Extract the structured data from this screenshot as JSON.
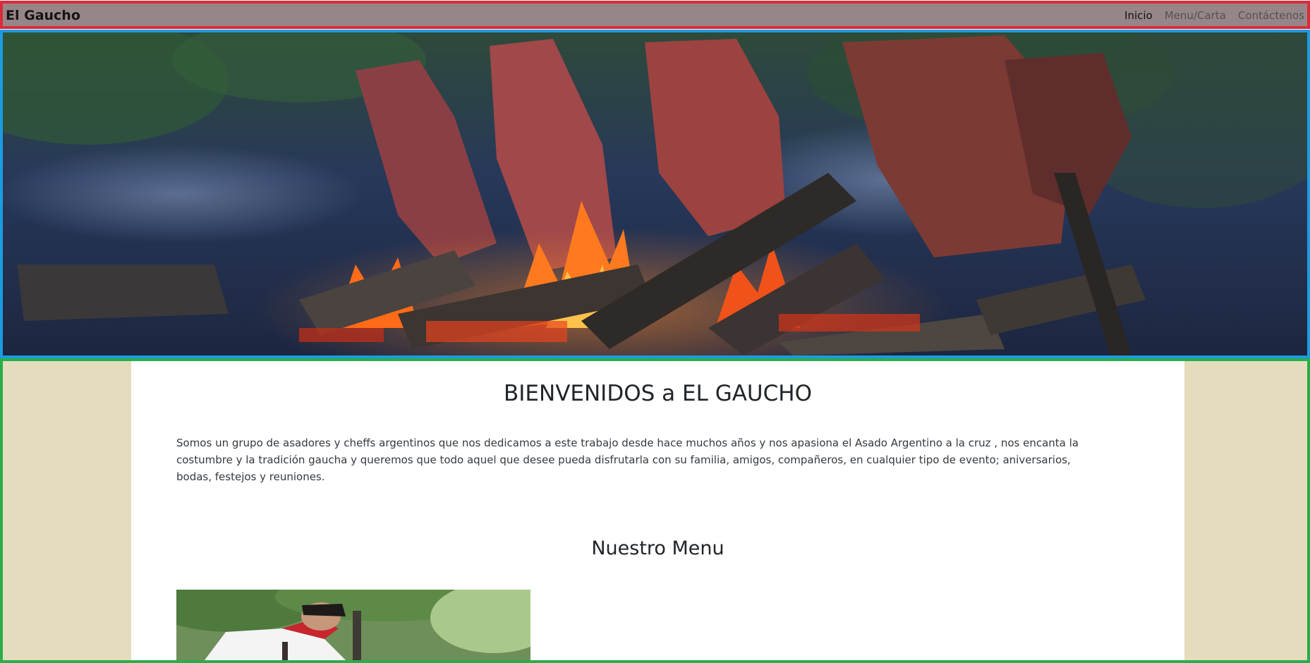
{
  "navbar": {
    "brand": "El Gaucho",
    "links": [
      {
        "label": "Inicio",
        "active": true
      },
      {
        "label": "Menu/Carta",
        "active": false
      },
      {
        "label": "Contáctenos",
        "active": false
      }
    ],
    "background": "#978687"
  },
  "hero": {
    "image": "asado-a-la-cruz-fire-image"
  },
  "main": {
    "background": "#e5dcbd",
    "title": "BIENVENIDOS a EL GAUCHO",
    "intro": "Somos un grupo de asadores y cheffs argentinos que nos dedicamos a este trabajo desde hace muchos años y nos apasiona el Asado Argentino a la cruz , nos encanta la costumbre y la tradición gaucha y queremos que todo aquel que desee pueda disfrutarla con su familia, amigos, compañeros, en cualquier tipo de evento; aniversarios, bodas, festejos y reuniones.",
    "menu_title": "Nuestro Menu",
    "menu_image": "gaucho-chef-photo"
  },
  "colors": {
    "annotation_red": "#dc2a38",
    "annotation_blue": "#1c9be0",
    "annotation_green": "#27ae4b"
  }
}
